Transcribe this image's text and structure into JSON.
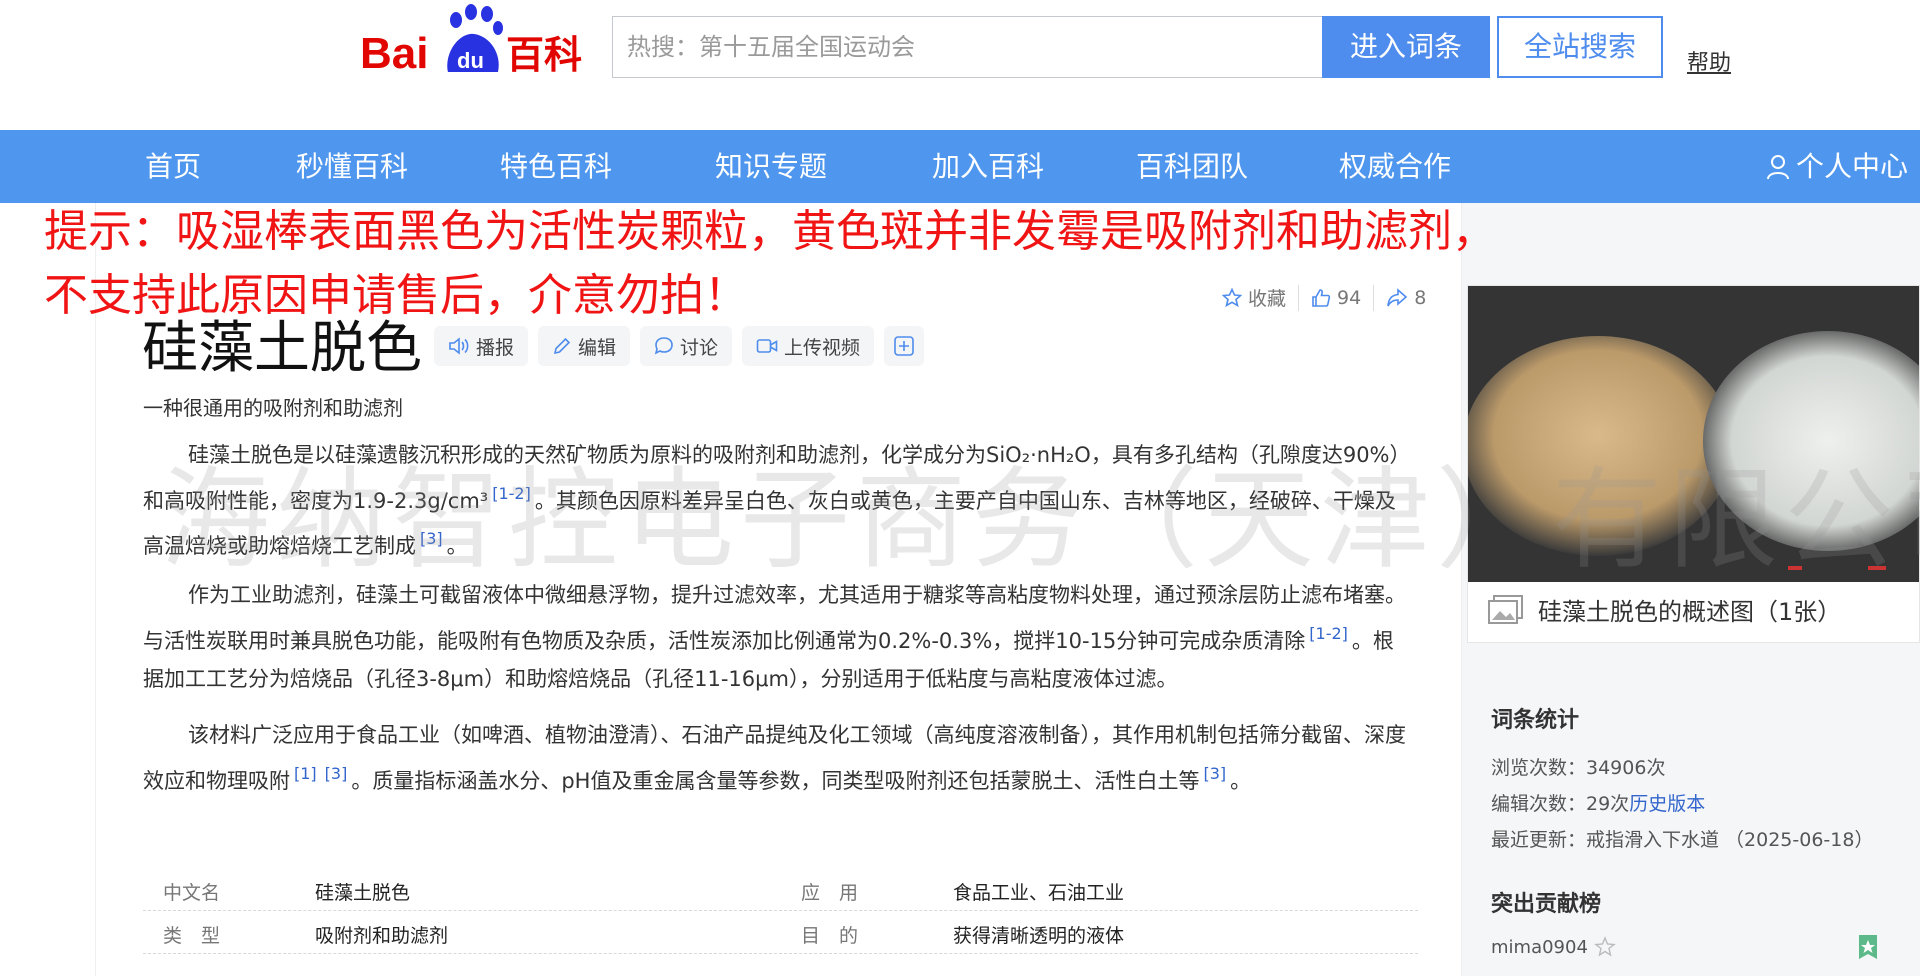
{
  "header": {
    "logo": {
      "bai": "Bai",
      "du": "du",
      "baike": "百科"
    },
    "search_placeholder": "热搜：第十五届全国运动会",
    "enter_button": "进入词条",
    "site_search_button": "全站搜索",
    "help_link": "帮助"
  },
  "nav": {
    "items": [
      "首页",
      "秒懂百科",
      "特色百科",
      "知识专题",
      "加入百科",
      "百科团队",
      "权威合作"
    ],
    "user_center": "个人中心"
  },
  "notice": {
    "line1": "提示：吸湿棒表面黑色为活性炭颗粒，黄色斑并非发霉是吸附剂和助滤剂，",
    "line2": "不支持此原因申请售后，介意勿拍！"
  },
  "actions": {
    "favorite": "收藏",
    "likes": "94",
    "shares": "8"
  },
  "article": {
    "title": "硅藻土脱色",
    "tools": {
      "broadcast": "播报",
      "edit": "编辑",
      "discuss": "讨论",
      "upload_video": "上传视频"
    },
    "subtitle": "一种很通用的吸附剂和助滤剂",
    "p1": {
      "t1": "硅藻土脱色是以硅藻遗骸沉积形成的天然矿物质为原料的吸附剂和助滤剂，化学成分为SiO₂·nH₂O，具有多孔结构（孔隙度达90%）和高吸附性能，密度为1.9-2.3g/cm³",
      "r1": "[1-2]",
      "t2": "。其颜色因原料差异呈白色、灰白或黄色，主要产自中国山东、吉林等地区，经破碎、干燥及高温焙烧或助熔焙烧工艺制成",
      "r2": "[3]",
      "t3": "。"
    },
    "p2": {
      "t1": "作为工业助滤剂，硅藻土可截留液体中微细悬浮物，提升过滤效率，尤其适用于糖浆等高粘度物料处理，通过预涂层防止滤布堵塞。与活性炭联用时兼具脱色功能，能吸附有色物质及杂质，活性炭添加比例通常为0.2%-0.3%，搅拌10-15分钟可完成杂质清除",
      "r1": "[1-2]",
      "t2": "。根据加工工艺分为焙烧品（孔径3-8μm）和助熔焙烧品（孔径11-16μm），分别适用于低粘度与高粘度液体过滤。"
    },
    "p3": {
      "t1": "该材料广泛应用于食品工业（如啤酒、植物油澄清）、石油产品提纯及化工领域（高纯度溶液制备），其作用机制包括筛分截留、深度效应和物理吸附",
      "r1": "[1]",
      "r2": "[3]",
      "t2": "。质量指标涵盖水分、pH值及重金属含量等参数，同类型吸附剂还包括蒙脱土、活性白土等",
      "r3": "[3]",
      "t3": "。"
    }
  },
  "info": {
    "rows": [
      {
        "l1": "中文名",
        "v1": "硅藻土脱色",
        "l2": "应　用",
        "v2": "食品工业、石油工业"
      },
      {
        "l1": "类　型",
        "v1": "吸附剂和助滤剂",
        "l2": "目　的",
        "v2": "获得清晰透明的液体"
      }
    ]
  },
  "sidebar": {
    "album_caption": "硅藻土脱色的概述图（1张）",
    "stats_title": "词条统计",
    "views": "浏览次数：34906次",
    "edits_prefix": "编辑次数：29次",
    "history_link": "历史版本",
    "last_update": "最近更新：戒指滑入下水道 （2025-06-18）",
    "contrib_title": "突出贡献榜",
    "contributor": "mima0904"
  },
  "watermark": "海纳智控电子商务（天津）有限公司",
  "colors": {
    "brand_blue": "#4f97ee",
    "button_blue": "#4e8cee",
    "notice_red": "#f01414",
    "link_blue": "#3366cc",
    "logo_red": "#e10601",
    "logo_blue": "#2932e1"
  }
}
